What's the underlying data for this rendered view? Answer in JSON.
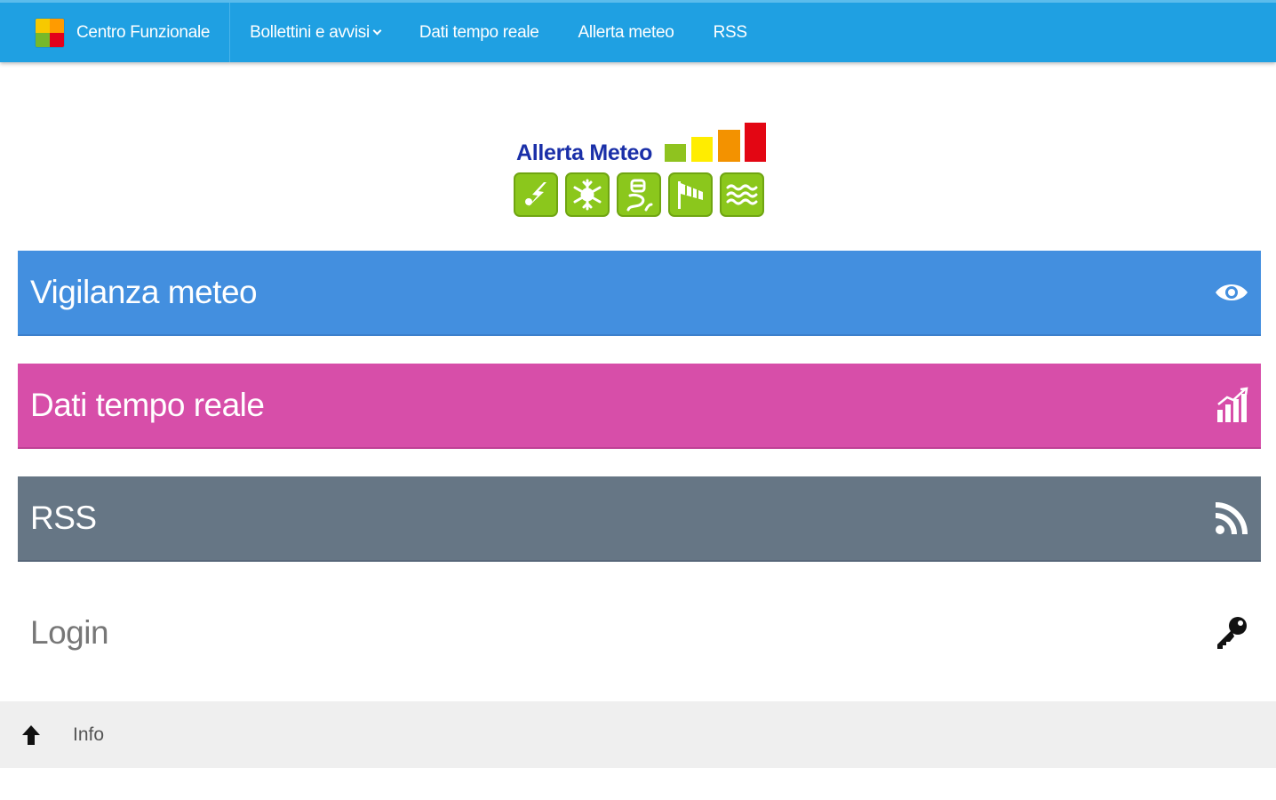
{
  "navbar": {
    "brand_label": "Centro Funzionale",
    "items": [
      {
        "label": "Bollettini e avvisi",
        "has_dropdown": true
      },
      {
        "label": "Dati tempo reale",
        "has_dropdown": false
      },
      {
        "label": "Allerta meteo",
        "has_dropdown": false
      },
      {
        "label": "RSS",
        "has_dropdown": false
      }
    ]
  },
  "logo": {
    "title": "Allerta Meteo",
    "level_colors": [
      "#8fc31f",
      "#ffed00",
      "#f39200",
      "#e30613"
    ],
    "hazard_icons": [
      "thunderstorm-icon",
      "snowflake-icon",
      "landslide-icon",
      "windsock-icon",
      "waves-icon"
    ]
  },
  "tiles": [
    {
      "label": "Vigilanza meteo",
      "icon": "eye-icon",
      "color": "#438fdf"
    },
    {
      "label": "Dati tempo reale",
      "icon": "bar-chart-icon",
      "color": "#d74ea9"
    },
    {
      "label": "RSS",
      "icon": "rss-icon",
      "color": "#667685"
    },
    {
      "label": "Login",
      "icon": "key-icon",
      "color": "#ffffff"
    }
  ],
  "footer": {
    "up_icon": "arrow-up-icon",
    "info_label": "Info"
  },
  "colors": {
    "navbar": "#1fa0e2",
    "footer": "#efefef"
  }
}
